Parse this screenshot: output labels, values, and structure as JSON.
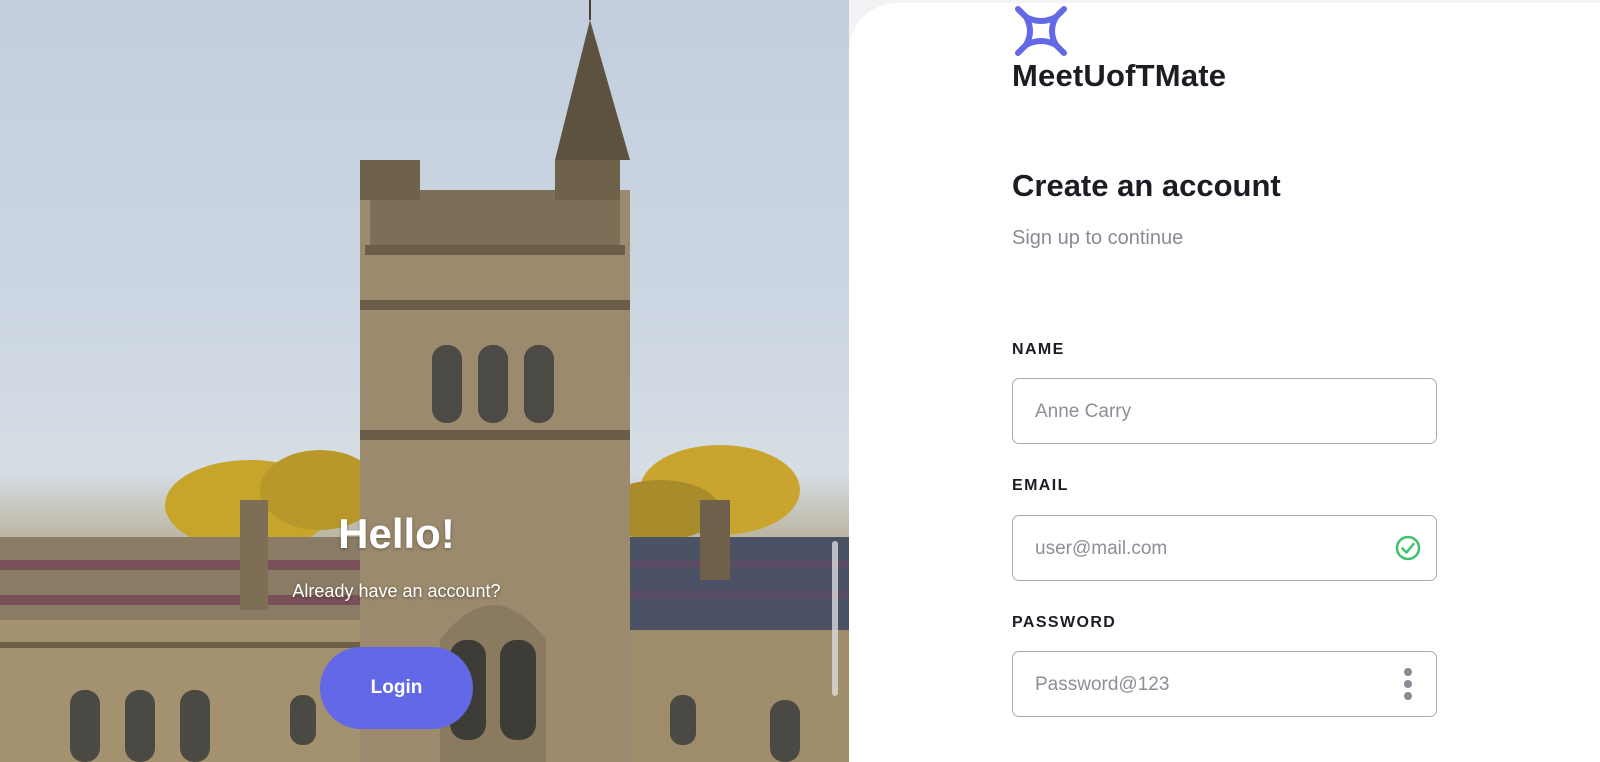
{
  "hero": {
    "title": "Hello!",
    "subtitle": "Already have an account?",
    "login_label": "Login"
  },
  "brand": {
    "name": "MeetUofTMate",
    "accent_color": "#6268e6"
  },
  "form": {
    "heading": "Create an account",
    "subheading": "Sign up to continue",
    "fields": [
      {
        "label": "NAME",
        "value": "",
        "placeholder": "Anne Carry",
        "icon": null
      },
      {
        "label": "EMAIL",
        "value": "",
        "placeholder": "user@mail.com",
        "icon": "check-circle-icon",
        "icon_color": "#3fc26b"
      },
      {
        "label": "PASSWORD",
        "value": "",
        "placeholder": "Password@123",
        "icon": "more-vertical-icon",
        "icon_color": "#8a8a95"
      }
    ]
  }
}
